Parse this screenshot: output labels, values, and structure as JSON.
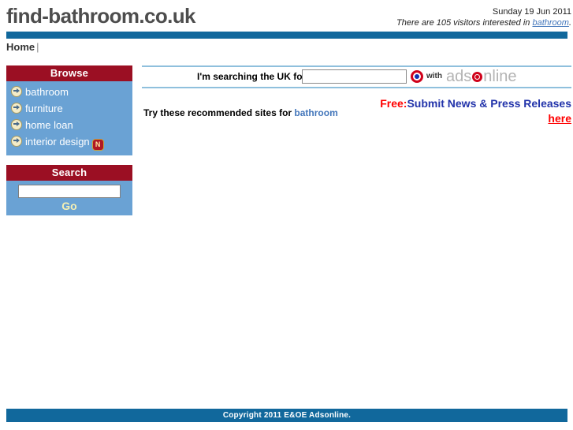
{
  "header": {
    "site_title": "find-bathroom.co.uk",
    "date": "Sunday 19 Jun 2011",
    "visitors_prefix": "There are 105 visitors interested in ",
    "visitors_keyword": "bathroom",
    "visitors_suffix": ".",
    "visitor_count": 105,
    "bar_color": "#11689c"
  },
  "breadcrumb": {
    "home_label": "Home",
    "separator": "|"
  },
  "sidebar": {
    "browse": {
      "title": "Browse",
      "items": [
        {
          "label": "bathroom",
          "badge": ""
        },
        {
          "label": "furniture",
          "badge": ""
        },
        {
          "label": "home loan",
          "badge": ""
        },
        {
          "label": "interior design",
          "badge": "N"
        }
      ]
    },
    "search": {
      "title": "Search",
      "input_value": "",
      "input_placeholder": "",
      "go_label": "Go"
    },
    "colors": {
      "panel_head": "#9b0f23",
      "panel_body": "#6aa2d4",
      "link_text": "#ffffff",
      "go_text": "#f5f0b4",
      "badge_bg": "#b01824"
    }
  },
  "main": {
    "search_prompt": "I'm searching the UK for...",
    "search_input_value": "",
    "search_input_placeholder": "",
    "with_label": "with",
    "ads_logo_part1": "ads",
    "ads_logo_part2": "nline",
    "recommend_prefix": "Try these recommended sites for ",
    "recommend_keyword": "bathroom",
    "promo": {
      "free_label": "Free:",
      "link_text": "Submit News & Press Releases ",
      "here_label": "here"
    },
    "colors": {
      "rule": "#8fc0dd",
      "promo_red": "#ff0000",
      "promo_blue": "#2233aa",
      "keyword_link": "#4477bb",
      "logo_grey": "#b3b3b3",
      "logo_red": "#d0021b"
    }
  },
  "footer": {
    "copyright": "Copyright 2011 E&OE Adsonline.",
    "bg_color": "#11689c"
  }
}
